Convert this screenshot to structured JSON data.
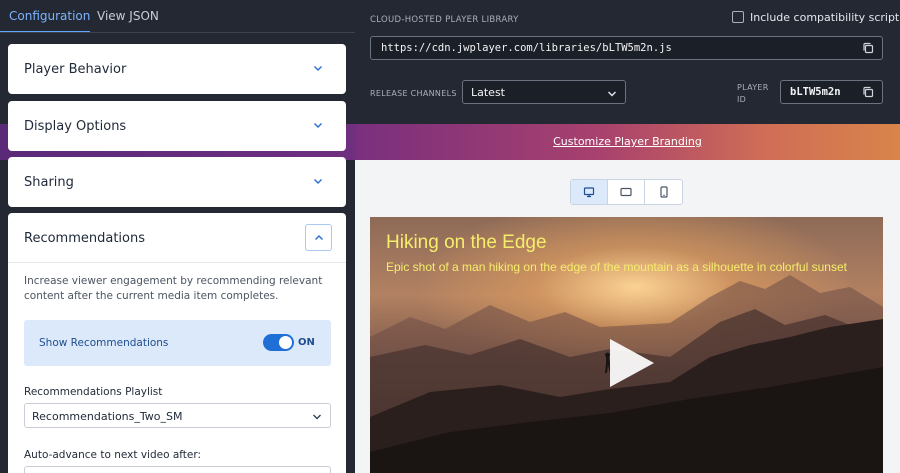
{
  "tabs": {
    "configuration": "Configuration",
    "view_json": "View JSON"
  },
  "sections": {
    "player_behavior": "Player Behavior",
    "display_options": "Display Options",
    "sharing": "Sharing"
  },
  "recommendations": {
    "title": "Recommendations",
    "description": "Increase viewer engagement by recommending relevant content after the current media item completes.",
    "show_label": "Show Recommendations",
    "toggle_state": "ON",
    "playlist_label": "Recommendations Playlist",
    "playlist_value": "Recommendations_Two_SM",
    "advance_label": "Auto-advance to next video after:"
  },
  "library": {
    "heading": "CLOUD-HOSTED PLAYER LIBRARY",
    "compat_label": "Include compatibility script",
    "compat_checked": false,
    "url": "https://cdn.jwplayer.com/libraries/bLTW5m2n.js",
    "release_label": "RELEASE CHANNELS",
    "release_value": "Latest",
    "player_id_label": "PLAYER ID",
    "player_id": "bLTW5m2n"
  },
  "branding": {
    "link": "Customize Player Branding"
  },
  "preview": {
    "devices": [
      "desktop-icon",
      "tablet-icon",
      "phone-icon"
    ],
    "selected_device": "desktop",
    "video_title": "Hiking on the Edge",
    "video_description": "Epic shot of a man hiking on the edge of the mountain as a silhouette in colorful sunset"
  },
  "colors": {
    "accent": "#1f6fd6",
    "title_overlay": "#f5ee6c",
    "dark_bg": "#232832"
  }
}
